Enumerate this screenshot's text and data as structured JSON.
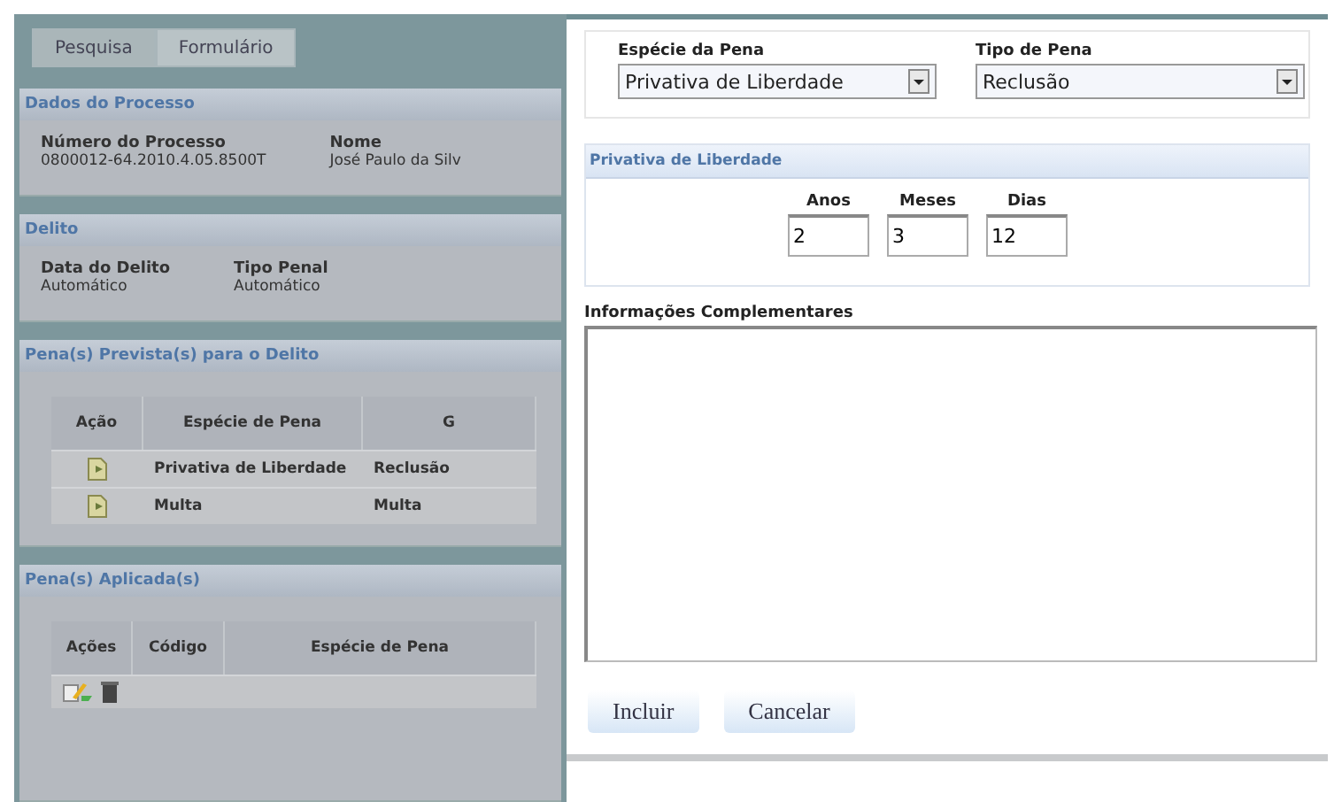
{
  "tabs": [
    {
      "label": "Pesquisa",
      "selected": false
    },
    {
      "label": "Formulário",
      "selected": true
    }
  ],
  "processo": {
    "title": "Dados do Processo",
    "fields": [
      {
        "label": "Número do Processo",
        "value": "0800012-64.2010.4.05.8500T"
      },
      {
        "label": "Nome",
        "value": "José Paulo da Silv"
      }
    ]
  },
  "delito": {
    "title": "Delito",
    "fields": [
      {
        "label": "Data do Delito",
        "value": "Automático"
      },
      {
        "label": "Tipo Penal",
        "value": "Automático"
      }
    ]
  },
  "previstas": {
    "title": "Pena(s) Prevista(s) para o Delito",
    "columns": [
      "Ação",
      "Espécie de Pena",
      "G"
    ],
    "rows": [
      {
        "especie": "Privativa de Liberdade",
        "tipo": "Reclusão"
      },
      {
        "especie": "Multa",
        "tipo": "Multa"
      }
    ]
  },
  "aplicadas": {
    "title": "Pena(s) Aplicada(s)",
    "columns": [
      "Ações",
      "Código",
      "Espécie de Pena"
    ]
  },
  "dialog": {
    "especie": {
      "label": "Espécie da Pena",
      "value": "Privativa de Liberdade"
    },
    "tipo": {
      "label": "Tipo de Pena",
      "value": "Reclusão"
    },
    "privativa": {
      "title": "Privativa de Liberdade",
      "fields": [
        {
          "label": "Anos",
          "value": "2"
        },
        {
          "label": "Meses",
          "value": "3"
        },
        {
          "label": "Dias",
          "value": "12"
        }
      ]
    },
    "info": {
      "label": "Informações Complementares"
    },
    "buttons": [
      "Incluir",
      "Cancelar"
    ]
  }
}
